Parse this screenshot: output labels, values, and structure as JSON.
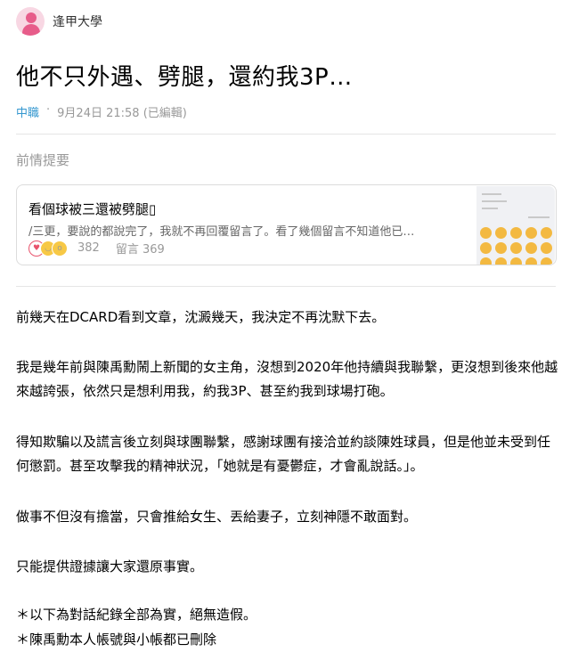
{
  "header": {
    "school": "逢甲大學"
  },
  "post": {
    "title": "他不只外遇、劈腿，還約我3P…",
    "board": "中職",
    "separator": "·",
    "time": "9月24日 21:58 (已編輯)"
  },
  "previous": {
    "label": "前情提要",
    "card": {
      "title": "看個球被三還被劈腿▯",
      "excerpt": "/三更，要說的都說完了，我就不再回覆留言了。看了幾個留言不知道他已…",
      "likes": "382",
      "comments": "留言 369"
    }
  },
  "content": {
    "p1": "前幾天在DCARD看到文章，沈澱幾天，我決定不再沈默下去。",
    "p2": "我是幾年前與陳禹勳鬧上新聞的女主角，沒想到2020年他持續與我聯繫，更沒想到後來他越來越誇張，依然只是想利用我，約我3P、甚至約我到球場打砲。",
    "p3": "得知欺騙以及謊言後立刻與球團聯繫，感謝球團有接洽並約談陳姓球員，但是他並未受到任何懲罰。甚至攻擊我的精神狀況，「她就是有憂鬱症，才會亂說話。」。",
    "p4": "做事不但沒有擔當，只會推給女生、丟給妻子，立刻神隱不敢面對。",
    "p5": "只能提供證據讓大家還原事實。",
    "p6": "＊以下為對話紀錄全部為實，絕無造假。",
    "p7": "＊陳禹勳本人帳號與小帳都已刪除"
  },
  "colors": {
    "board": "#3397cf",
    "meta": "#999999",
    "accent": "#e75c8a"
  }
}
